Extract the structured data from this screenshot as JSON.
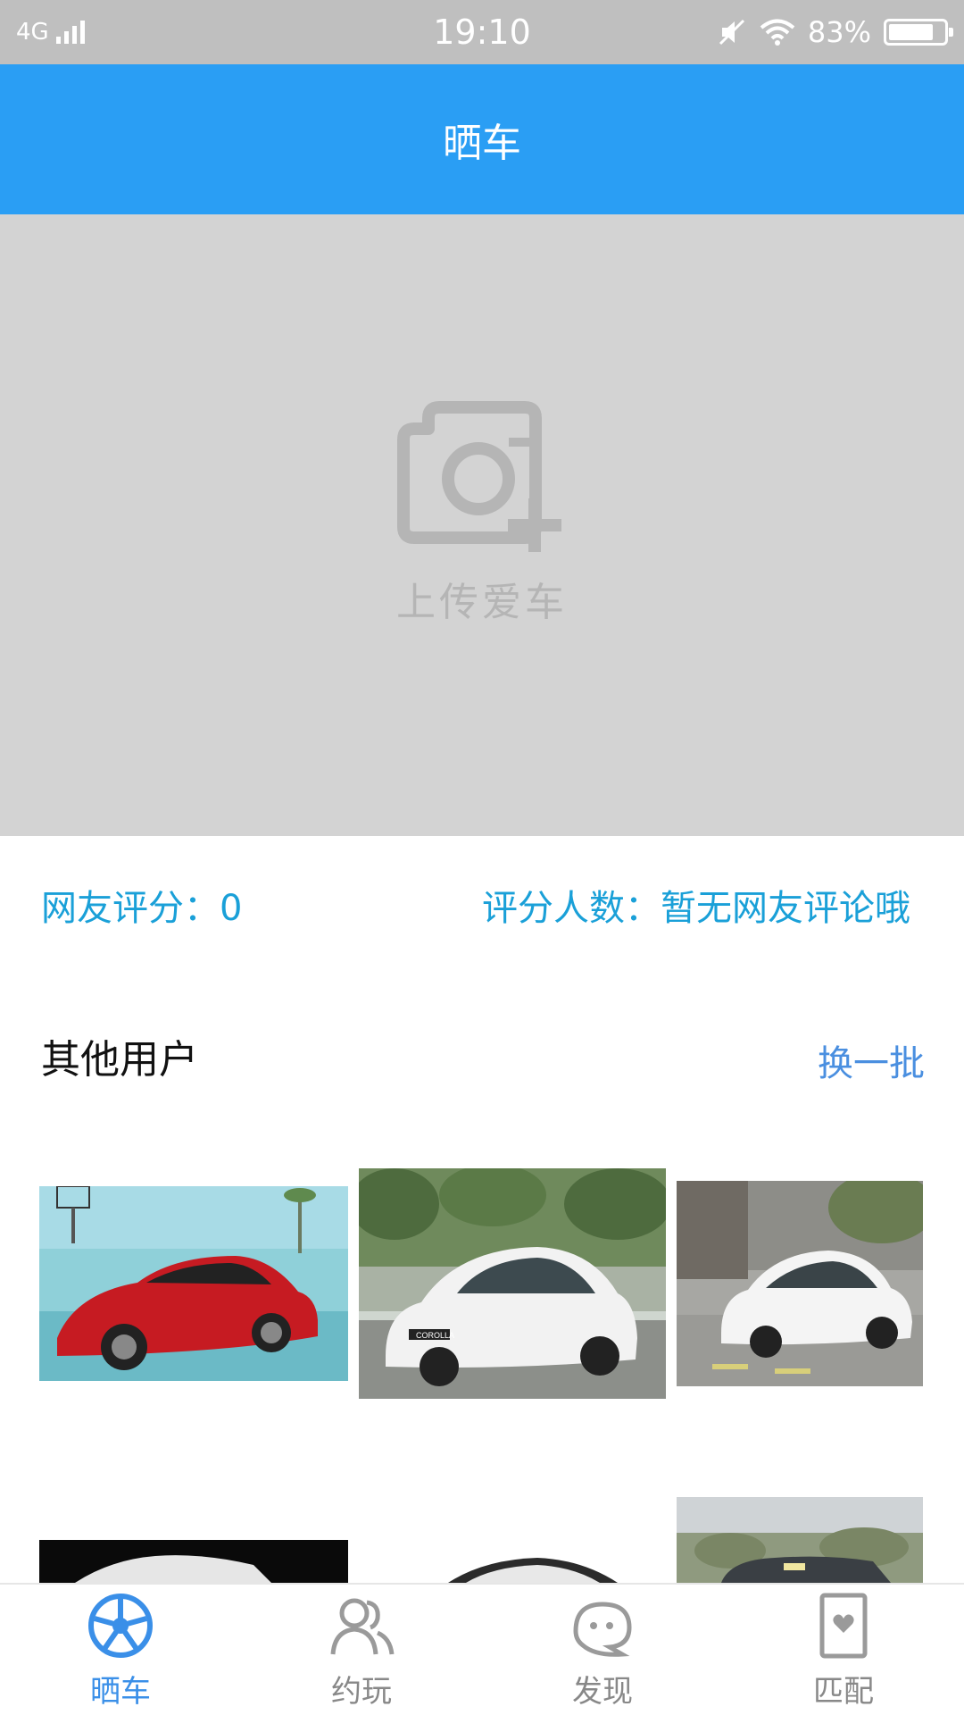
{
  "status_bar": {
    "network": "4G",
    "time": "19:10",
    "battery_text": "83%",
    "battery_level": 0.83
  },
  "header": {
    "title": "晒车"
  },
  "upload": {
    "label": "上传爱车",
    "icon": "camera-plus-icon"
  },
  "rating": {
    "score_text": "网友评分：0",
    "count_text": "评分人数：暂无网友评论哦"
  },
  "others": {
    "title": "其他用户",
    "refresh_label": "换一批",
    "cars": [
      {
        "name": "red-sedan"
      },
      {
        "name": "white-toyota-corolla",
        "badge": "COROLLA"
      },
      {
        "name": "white-ford-sedan"
      },
      {
        "name": "black-background-sedan"
      },
      {
        "name": "white-sedan"
      },
      {
        "name": "outdoor-suv"
      }
    ]
  },
  "tabbar": {
    "items": [
      {
        "label": "晒车",
        "icon": "steering-wheel-icon",
        "active": true
      },
      {
        "label": "约玩",
        "icon": "users-icon",
        "active": false
      },
      {
        "label": "发现",
        "icon": "chat-face-icon",
        "active": false
      },
      {
        "label": "匹配",
        "icon": "heart-card-icon",
        "active": false
      }
    ]
  },
  "colors": {
    "primary": "#2a9ef4",
    "rating_text": "#1aa0d8",
    "refresh_text": "#4a8fe0",
    "tab_active": "#3a8fe8",
    "tab_inactive": "#888888"
  }
}
